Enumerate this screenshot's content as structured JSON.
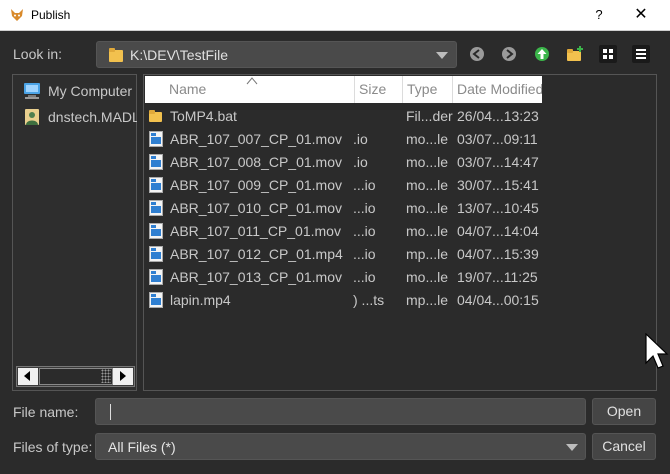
{
  "window": {
    "title": "Publish",
    "help_label": "?",
    "close_label": "✕"
  },
  "toolbar": {
    "look_in_label": "Look in:",
    "current_path": "K:\\DEV\\TestFile"
  },
  "sidebar": {
    "items": [
      {
        "label": "My Computer",
        "icon": "computer-icon"
      },
      {
        "label": "dnstech.MADL",
        "icon": "user-folder-icon"
      }
    ]
  },
  "file_list": {
    "columns": [
      "Name",
      "Size",
      "Type",
      "Date Modified"
    ],
    "rows": [
      {
        "name": "ToMP4.bat",
        "size": "",
        "type": "Fil...der",
        "date": "26/04...13:23",
        "icon": "folder-icon"
      },
      {
        "name": "ABR_107_007_CP_01.mov",
        "size": ".io",
        "type": "mo...le",
        "date": "03/07...09:11",
        "icon": "video-file-icon"
      },
      {
        "name": "ABR_107_008_CP_01.mov",
        "size": ".io",
        "type": "mo...le",
        "date": "03/07...14:47",
        "icon": "video-file-icon"
      },
      {
        "name": "ABR_107_009_CP_01.mov",
        "size": "...io",
        "type": "mo...le",
        "date": "30/07...15:41",
        "icon": "video-file-icon"
      },
      {
        "name": "ABR_107_010_CP_01.mov",
        "size": "...io",
        "type": "mo...le",
        "date": "13/07...10:45",
        "icon": "video-file-icon"
      },
      {
        "name": "ABR_107_011_CP_01.mov",
        "size": "...io",
        "type": "mo...le",
        "date": "04/07...14:04",
        "icon": "video-file-icon"
      },
      {
        "name": "ABR_107_012_CP_01.mp4",
        "size": "...io",
        "type": "mp...le",
        "date": "04/07...15:39",
        "icon": "video-file-icon"
      },
      {
        "name": "ABR_107_013_CP_01.mov",
        "size": "...io",
        "type": "mo...le",
        "date": "19/07...11:25",
        "icon": "video-file-icon"
      },
      {
        "name": "lapin.mp4",
        "size": ") ...ts",
        "type": "mp...le",
        "date": "04/04...00:15",
        "icon": "video-file-icon"
      }
    ]
  },
  "footer": {
    "file_name_label": "File name:",
    "file_name_value": "",
    "files_of_type_label": "Files of type:",
    "files_of_type_value": "All Files (*)",
    "open_label": "Open",
    "cancel_label": "Cancel"
  },
  "colors": {
    "background": "#2b2b2b",
    "field": "#4a4a4a",
    "folder": "#f2c14e",
    "up_arrow": "#3bb54a"
  }
}
